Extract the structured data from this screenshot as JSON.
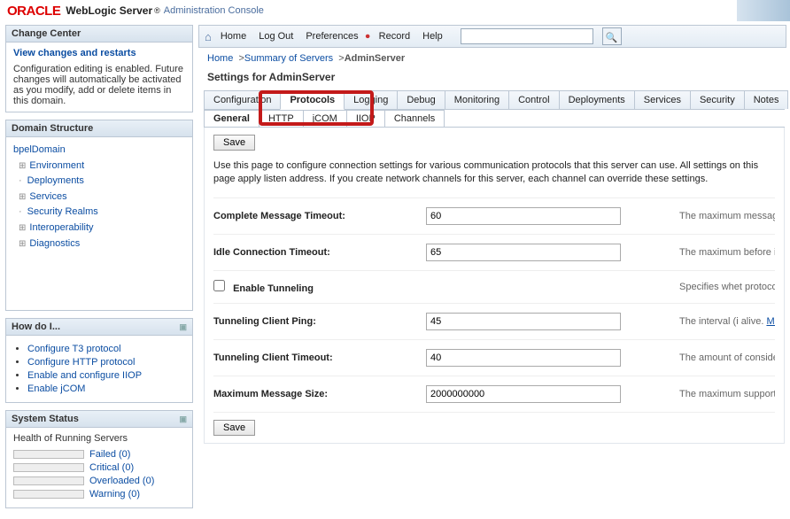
{
  "brand": {
    "oracle": "ORACLE",
    "product": "WebLogic Server",
    "tagline": "Administration Console"
  },
  "toolbar": {
    "home": "Home",
    "logout": "Log Out",
    "preferences": "Preferences",
    "record": "Record",
    "help": "Help",
    "search_placeholder": ""
  },
  "breadcrumb": {
    "home": "Home",
    "summary": "Summary of Servers",
    "current": "AdminServer"
  },
  "settings_title": "Settings for AdminServer",
  "change_center": {
    "title": "Change Center",
    "view_link": "View changes and restarts",
    "body": "Configuration editing is enabled. Future changes will automatically be activated as you modify, add or delete items in this domain."
  },
  "domain_structure": {
    "title": "Domain Structure",
    "root": "bpelDomain",
    "nodes": [
      {
        "label": "Environment",
        "expandable": true
      },
      {
        "label": "Deployments",
        "expandable": false
      },
      {
        "label": "Services",
        "expandable": true
      },
      {
        "label": "Security Realms",
        "expandable": false
      },
      {
        "label": "Interoperability",
        "expandable": true
      },
      {
        "label": "Diagnostics",
        "expandable": true
      }
    ]
  },
  "how_do_i": {
    "title": "How do I...",
    "items": [
      "Configure T3 protocol",
      "Configure HTTP protocol",
      "Enable and configure IIOP",
      "Enable jCOM"
    ]
  },
  "system_status": {
    "title": "System Status",
    "subtitle": "Health of Running Servers",
    "rows": [
      {
        "label": "Failed (0)"
      },
      {
        "label": "Critical (0)"
      },
      {
        "label": "Overloaded (0)"
      },
      {
        "label": "Warning (0)"
      }
    ]
  },
  "main_tabs": [
    "Configuration",
    "Protocols",
    "Logging",
    "Debug",
    "Monitoring",
    "Control",
    "Deployments",
    "Services",
    "Security",
    "Notes"
  ],
  "sub_tabs": [
    "General",
    "HTTP",
    "jCOM",
    "IIOP",
    "Channels"
  ],
  "buttons": {
    "save": "Save"
  },
  "page_description": "Use this page to configure connection settings for various communication protocols that this server can use. All settings on this page apply listen address. If you create network channels for this server, each channel can override these settings.",
  "form": {
    "complete_message_timeout": {
      "label": "Complete Message Timeout:",
      "value": "60",
      "help": "The maximum message to be each channel c"
    },
    "idle_connection_timeout": {
      "label": "Idle Connection Timeout:",
      "value": "65",
      "help": "The maximum before it is clo attribute. If yo override this i"
    },
    "enable_tunneling": {
      "label": "Enable Tunneling",
      "checked": false,
      "help": "Specifies whet protocols shou"
    },
    "tunneling_client_ping": {
      "label": "Tunneling Client Ping:",
      "value": "45",
      "help": "The interval (i alive.",
      "help_link": "More I"
    },
    "tunneling_client_timeout": {
      "label": "Tunneling Client Timeout:",
      "value": "40",
      "help": "The amount of considered dea"
    },
    "maximum_message_size": {
      "label": "Maximum Message Size:",
      "value": "2000000000",
      "help": "The maximum supported prot custom channe"
    }
  }
}
